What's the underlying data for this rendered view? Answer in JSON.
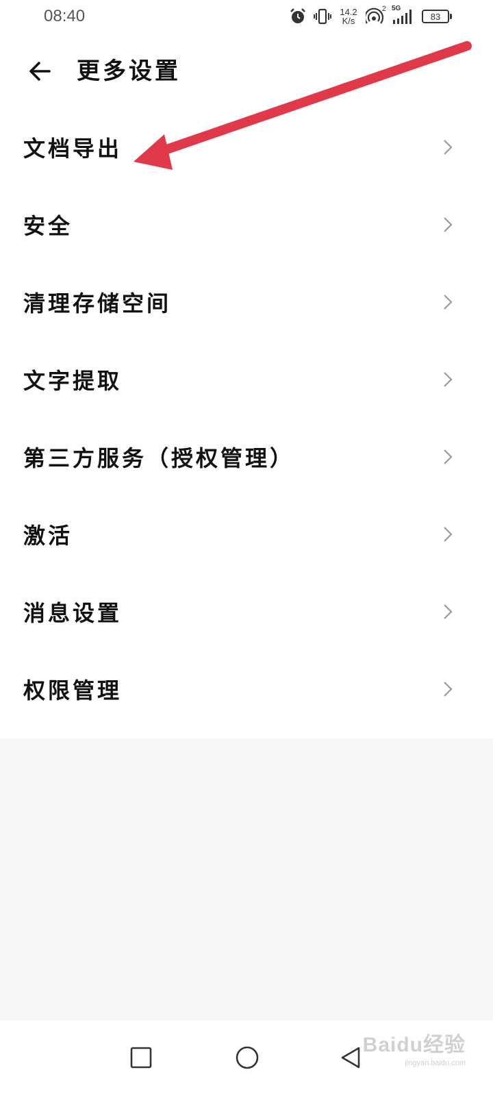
{
  "status_bar": {
    "time": "08:40",
    "speed_value": "14.2",
    "speed_unit": "K/s",
    "signal_label": "5G",
    "hotspot_count": "2",
    "battery": "83"
  },
  "header": {
    "title": "更多设置",
    "back_icon": "arrow-left-icon"
  },
  "settings_items": [
    {
      "label": "文档导出"
    },
    {
      "label": "安全"
    },
    {
      "label": "清理存储空间"
    },
    {
      "label": "文字提取"
    },
    {
      "label": "第三方服务（授权管理）"
    },
    {
      "label": "激活"
    },
    {
      "label": "消息设置"
    },
    {
      "label": "权限管理"
    }
  ],
  "annotation": {
    "arrow_color": "#e0394a"
  },
  "nav_bar": {
    "icons": [
      "square-icon",
      "circle-icon",
      "triangle-back-icon"
    ]
  },
  "watermark": {
    "main": "Baidu经验",
    "sub": "jingyan.baidu.com"
  }
}
